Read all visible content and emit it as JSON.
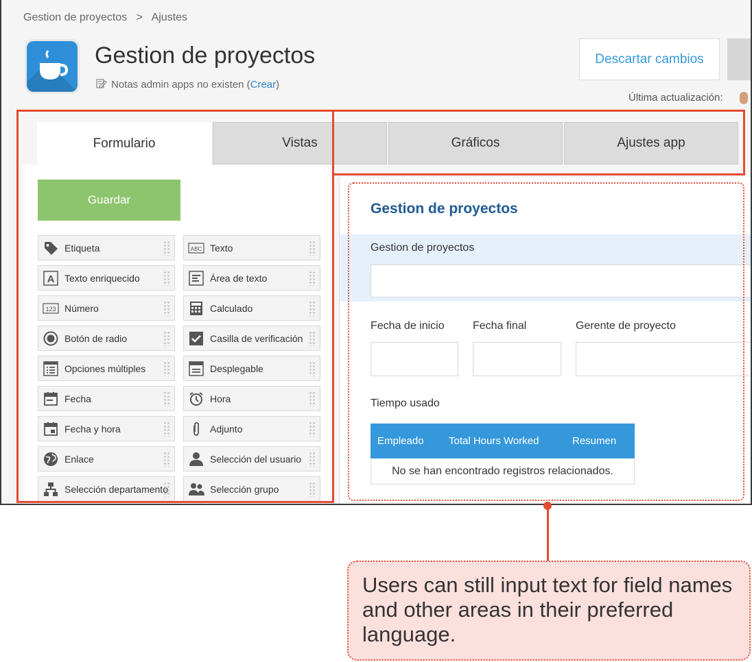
{
  "breadcrumb": {
    "root": "Gestion de proyectos",
    "separator": ">",
    "current": "Ajustes"
  },
  "app": {
    "title": "Gestion de proyectos",
    "notes_text": "Notas admin apps no existen (",
    "notes_link": "Crear",
    "notes_close": ")",
    "icon": "coffee-cup-icon"
  },
  "header": {
    "discard_label": "Descartar cambios",
    "last_update_label": "Última actualización:"
  },
  "tabs": [
    {
      "label": "Formulario",
      "active": true
    },
    {
      "label": "Vistas",
      "active": false
    },
    {
      "label": "Gráficos",
      "active": false
    },
    {
      "label": "Ajustes app",
      "active": false
    }
  ],
  "palette": {
    "save_label": "Guardar",
    "items": [
      {
        "label": "Etiqueta",
        "icon": "tag-icon"
      },
      {
        "label": "Texto",
        "icon": "abc-text-icon"
      },
      {
        "label": "Texto enriquecido",
        "icon": "rich-text-icon"
      },
      {
        "label": "Área de texto",
        "icon": "text-area-icon"
      },
      {
        "label": "Número",
        "icon": "number-icon"
      },
      {
        "label": "Calculado",
        "icon": "calculator-icon"
      },
      {
        "label": "Botón de radio",
        "icon": "radio-icon"
      },
      {
        "label": "Casilla de verificación",
        "icon": "checkbox-icon"
      },
      {
        "label": "Opciones múltiples",
        "icon": "multi-choice-icon"
      },
      {
        "label": "Desplegable",
        "icon": "dropdown-icon"
      },
      {
        "label": "Fecha",
        "icon": "calendar-icon"
      },
      {
        "label": "Hora",
        "icon": "alarm-clock-icon"
      },
      {
        "label": "Fecha y hora",
        "icon": "calendar-time-icon"
      },
      {
        "label": "Adjunto",
        "icon": "paperclip-icon"
      },
      {
        "label": "Enlace",
        "icon": "globe-icon"
      },
      {
        "label": "Selección del usuario",
        "icon": "user-icon"
      },
      {
        "label": "Selección departamento",
        "icon": "org-chart-icon"
      },
      {
        "label": "Selección grupo",
        "icon": "group-icon"
      }
    ]
  },
  "form": {
    "title": "Gestion de proyectos",
    "name_label": "Gestion de proyectos",
    "start_date_label": "Fecha de inicio",
    "end_date_label": "Fecha final",
    "manager_label": "Gerente de proyecto",
    "time_used_label": "Tiempo usado",
    "table_headers": [
      "Empleado",
      "Total Hours Worked",
      "Resumen"
    ],
    "table_empty": "No se han encontrado registros relacionados."
  },
  "callout": {
    "text": "Users can still input text for field names and other areas in their preferred language."
  },
  "colors": {
    "accent_blue": "#3498db",
    "save_green": "#8dc56e",
    "highlight_red": "#e44b34",
    "callout_bg": "#fbe0de",
    "title_blue": "#1f5a93"
  }
}
